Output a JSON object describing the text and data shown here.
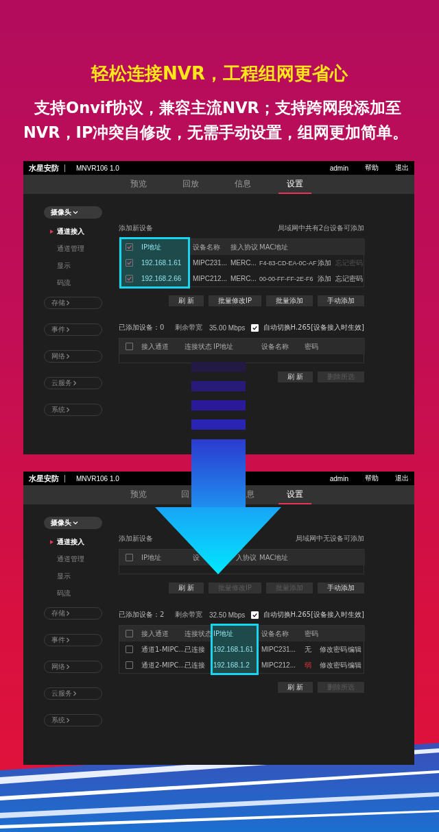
{
  "headline": "轻松连接NVR，工程组网更省心",
  "description": "支持Onvif协议，兼容主流NVR；支持跨网段添加至NVR，IP冲突自修改，无需手动设置，组网更加简单。",
  "screens": [
    {
      "brand": "水星安防",
      "model": "MNVR106 1.0",
      "user": "admin",
      "help": "帮助",
      "logout": "退出",
      "tabs": [
        {
          "label": "预览",
          "selected": false
        },
        {
          "label": "回放",
          "selected": false
        },
        {
          "label": "信息",
          "selected": false
        },
        {
          "label": "设置",
          "selected": true
        }
      ],
      "sidebar": {
        "group": "摄像头",
        "items": [
          {
            "label": "通道接入",
            "selected": true
          },
          {
            "label": "通道管理",
            "selected": false
          },
          {
            "label": "显示",
            "selected": false
          },
          {
            "label": "码流",
            "selected": false
          }
        ],
        "sections": [
          "存储",
          "事件",
          "网络",
          "云服务",
          "系统"
        ]
      },
      "add_panel": {
        "title": "添加新设备",
        "note": "局域网中共有2台设备可添加",
        "columns": [
          {
            "kind": "checkbox",
            "checked": true,
            "highlighted": true
          },
          {
            "kind": "label",
            "label": "IP地址",
            "highlighted": true
          },
          {
            "kind": "label",
            "label": "设备名称",
            "highlighted": false
          },
          {
            "kind": "label",
            "label": "接入协议",
            "highlighted": false
          },
          {
            "kind": "label",
            "label": "MAC地址",
            "highlighted": false
          }
        ],
        "rows": [
          {
            "cells": [
              {
                "kind": "checkbox",
                "checked": true
              },
              {
                "kind": "text",
                "text": "192.168.1.61"
              },
              {
                "kind": "text",
                "text": "MIPC231..."
              },
              {
                "kind": "text",
                "text": "MERC..."
              },
              {
                "kind": "text",
                "text": "F4-83-CD-EA-0C-AF"
              },
              {
                "kind": "action",
                "text": "添加",
                "disabled": false
              },
              {
                "kind": "action",
                "text": "忘记密码",
                "disabled": true
              }
            ]
          },
          {
            "cells": [
              {
                "kind": "checkbox",
                "checked": true
              },
              {
                "kind": "text",
                "text": "192.168.2.66"
              },
              {
                "kind": "text",
                "text": "MIPC212..."
              },
              {
                "kind": "text",
                "text": "MERC..."
              },
              {
                "kind": "text",
                "text": "00-00-FF-FF-2E-F6"
              },
              {
                "kind": "action",
                "text": "添加",
                "disabled": false
              },
              {
                "kind": "action",
                "text": "忘记密码",
                "disabled": false
              }
            ]
          }
        ],
        "buttons": [
          {
            "label": "刷 新",
            "disabled": false
          },
          {
            "label": "批量修改IP",
            "disabled": false
          },
          {
            "label": "批量添加",
            "disabled": false
          },
          {
            "label": "手动添加",
            "disabled": false
          }
        ]
      },
      "added_panel": {
        "count": "已添加设备：0",
        "bandwidth_label": "剩余带宽",
        "bandwidth": "35.00 Mbps",
        "auto_h265": {
          "label": "自动切换H.265[设备接入时生效]",
          "checked": true
        },
        "columns": [
          {
            "kind": "checkbox",
            "checked": false,
            "highlighted": false
          },
          {
            "kind": "label",
            "label": "接入通道",
            "highlighted": false
          },
          {
            "kind": "label",
            "label": "连接状态",
            "highlighted": false
          },
          {
            "kind": "label",
            "label": "IP地址",
            "highlighted": false
          },
          {
            "kind": "label",
            "label": "设备名称",
            "highlighted": false
          },
          {
            "kind": "label",
            "label": "密码",
            "highlighted": false
          }
        ],
        "buttons": [
          {
            "label": "刷 新",
            "disabled": false
          },
          {
            "label": "删除所选",
            "disabled": true
          }
        ]
      }
    },
    {
      "brand": "水星安防",
      "model": "MNVR106 1.0",
      "user": "admin",
      "help": "帮助",
      "logout": "退出",
      "tabs": [
        {
          "label": "预览",
          "selected": false
        },
        {
          "label": "回",
          "selected": false,
          "clipped_end": true
        },
        {
          "label": "息",
          "selected": false,
          "clipped_start": true
        },
        {
          "label": "设置",
          "selected": true
        }
      ],
      "sidebar": {
        "group": "摄像头",
        "items": [
          {
            "label": "通道接入",
            "selected": true
          },
          {
            "label": "通道管理",
            "selected": false
          },
          {
            "label": "显示",
            "selected": false
          },
          {
            "label": "码流",
            "selected": false
          }
        ],
        "sections": [
          "存储",
          "事件",
          "网络",
          "云服务",
          "系统"
        ]
      },
      "add_panel": {
        "title": "添加新设备",
        "note": "局域网中无设备可添加",
        "columns": [
          {
            "kind": "checkbox",
            "checked": false,
            "highlighted": false
          },
          {
            "kind": "label",
            "label": "IP地址",
            "highlighted": false
          },
          {
            "kind": "label",
            "label": "设",
            "highlighted": false
          },
          {
            "kind": "label",
            "label": "入协议",
            "highlighted": false,
            "clipped_start": true
          },
          {
            "kind": "label",
            "label": "MAC地址",
            "highlighted": false
          }
        ],
        "buttons": [
          {
            "label": "刷 新",
            "disabled": false
          },
          {
            "label": "批量修改IP",
            "disabled": true
          },
          {
            "label": "批量添加",
            "disabled": true
          },
          {
            "label": "手动添加",
            "disabled": false
          }
        ]
      },
      "added_panel": {
        "count": "已添加设备：2",
        "bandwidth_label": "剩余带宽",
        "bandwidth": "32.50 Mbps",
        "auto_h265": {
          "label": "自动切换H.265[设备接入时生效]",
          "checked": true
        },
        "columns": [
          {
            "kind": "checkbox",
            "checked": false,
            "highlighted": false
          },
          {
            "kind": "label",
            "label": "接入通道",
            "highlighted": false
          },
          {
            "kind": "label",
            "label": "连接状态",
            "highlighted": false
          },
          {
            "kind": "label",
            "label": "IP地址",
            "highlighted": true
          },
          {
            "kind": "label",
            "label": "设备名称",
            "highlighted": false
          },
          {
            "kind": "label",
            "label": "密码",
            "highlighted": false
          }
        ],
        "rows": [
          {
            "cells": [
              {
                "kind": "checkbox",
                "checked": false
              },
              {
                "kind": "text",
                "text": "通道1-MIPC..."
              },
              {
                "kind": "text",
                "text": "已连接"
              },
              {
                "kind": "text",
                "text": "192.168.1.61"
              },
              {
                "kind": "text",
                "text": "MIPC231..."
              },
              {
                "kind": "text",
                "text": "无"
              },
              {
                "kind": "action",
                "text": "修改密码",
                "disabled": false
              },
              {
                "kind": "action",
                "text": "编辑",
                "disabled": false
              }
            ]
          },
          {
            "cells": [
              {
                "kind": "checkbox",
                "checked": false
              },
              {
                "kind": "text",
                "text": "通道2-MIPC..."
              },
              {
                "kind": "text",
                "text": "已连接"
              },
              {
                "kind": "text",
                "text": "192.168.1.2"
              },
              {
                "kind": "text",
                "text": "MIPC212..."
              },
              {
                "kind": "warning",
                "text": "弱"
              },
              {
                "kind": "action",
                "text": "修改密码",
                "disabled": false
              },
              {
                "kind": "action",
                "text": "编辑",
                "disabled": false
              }
            ]
          }
        ],
        "buttons": [
          {
            "label": "刷 新",
            "disabled": false
          },
          {
            "label": "删除所选",
            "disabled": true
          }
        ]
      }
    }
  ]
}
